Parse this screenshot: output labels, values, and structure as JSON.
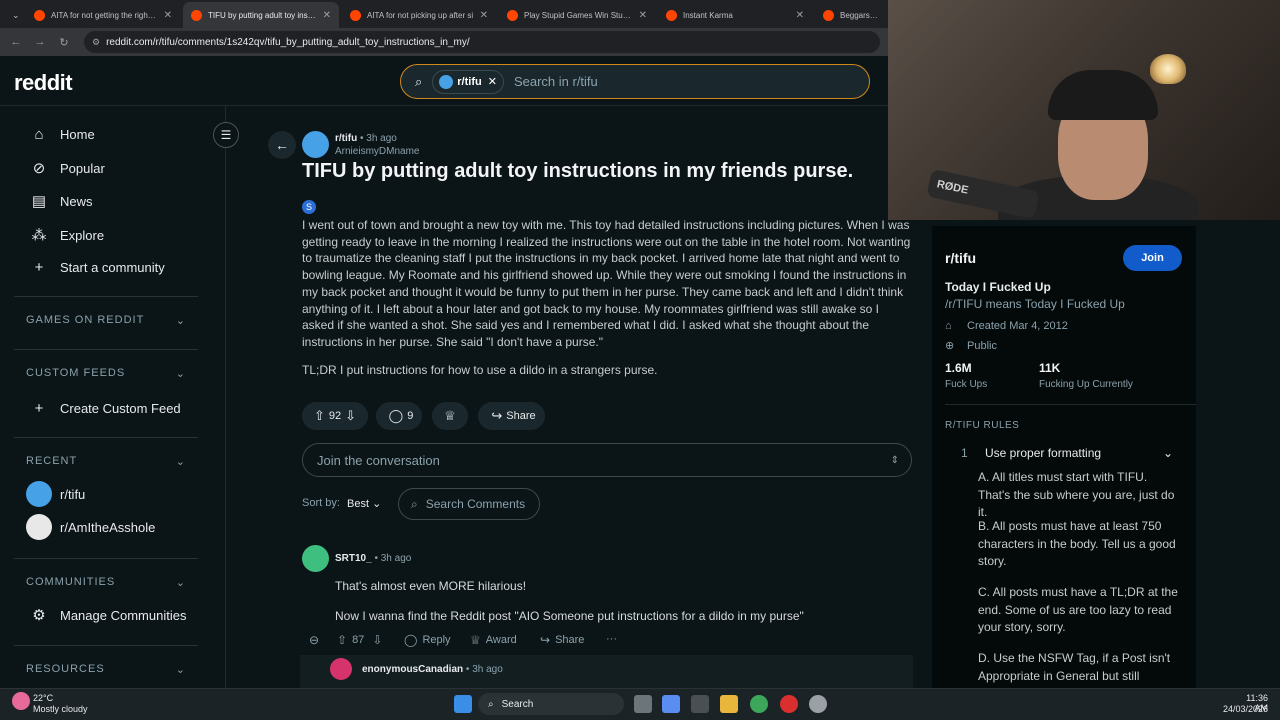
{
  "browser": {
    "tabs": [
      {
        "label": "AITA for not getting the right m",
        "active": false
      },
      {
        "label": "TIFU by putting adult toy instruc",
        "active": true
      },
      {
        "label": "AITA for not picking up after si",
        "active": false
      },
      {
        "label": "Play Stupid Games Win Stupid I",
        "active": false
      },
      {
        "label": "Instant Karma",
        "active": false
      },
      {
        "label": "Beggars can't",
        "active": false
      }
    ],
    "url": "reddit.com/r/tifu/comments/1s242qv/tifu_by_putting_adult_toy_instructions_in_my/"
  },
  "header": {
    "logo": "reddit",
    "search_chip": "r/tifu",
    "search_placeholder": "Search in r/tifu"
  },
  "sidebar": {
    "nav": [
      {
        "label": "Home",
        "icon": "home-icon"
      },
      {
        "label": "Popular",
        "icon": "popular-icon"
      },
      {
        "label": "News",
        "icon": "news-icon"
      },
      {
        "label": "Explore",
        "icon": "explore-icon"
      },
      {
        "label": "Start a community",
        "icon": "plus-icon"
      }
    ],
    "games_header": "GAMES ON REDDIT",
    "custom_feeds_header": "CUSTOM FEEDS",
    "create_custom_feed": "Create Custom Feed",
    "recent_header": "RECENT",
    "recent": [
      "r/tifu",
      "r/AmItheAsshole"
    ],
    "communities_header": "COMMUNITIES",
    "manage_communities": "Manage Communities",
    "resources_header": "RESOURCES"
  },
  "post": {
    "subreddit": "r/tifu",
    "time": "3h ago",
    "author": "ArnieismyDMname",
    "title": "TIFU by putting adult toy instructions in my friends purse.",
    "badge": "S",
    "body": "I went out of town and brought a new toy with me. This toy had detailed instructions including pictures. When I was getting ready to leave in the morning I realized the instructions were out on the table in the hotel room. Not wanting to traumatize the cleaning staff I put the instructions in my back pocket. I arrived home late that night and went to bowling league. My Roomate and his girlfriend showed up. While they were out smoking I found the instructions in my back pocket and thought it would be funny to put them in her purse. They came back and left and I didn't think anything of it. I left about a hour later and got back to my house. My roommates girlfriend was still awake so I asked if she wanted a shot. She said yes and I remembered what I did. I asked what she thought about the instructions in her purse. She said \"I don't have a purse.\"",
    "tldr": "TL;DR I put instructions for how to use a dildo in a strangers purse.",
    "votes": "92",
    "comments": "9",
    "share": "Share"
  },
  "conversation": {
    "placeholder": "Join the conversation",
    "sort_label": "Sort by:",
    "sort_value": "Best",
    "search_comments": "Search Comments"
  },
  "comments": [
    {
      "author": "SRT10_",
      "time": "3h ago",
      "lines": [
        "That's almost even MORE hilarious!",
        "Now I wanna find the Reddit post \"AIO Someone put instructions for a dildo in my purse\""
      ],
      "votes": "87",
      "reply": "Reply",
      "award": "Award",
      "share": "Share"
    },
    {
      "author": "enonymousCanadian",
      "time": "3h ago"
    }
  ],
  "community": {
    "name": "r/tifu",
    "join": "Join",
    "tagline": "Today I Fucked Up",
    "description": "/r/TIFU means Today I Fucked Up",
    "created": "Created Mar 4, 2012",
    "visibility": "Public",
    "members": "1.6M",
    "members_label": "Fuck Ups",
    "online": "11K",
    "online_label": "Fucking Up Currently",
    "rules_header": "R/TIFU RULES",
    "rule_number": "1",
    "rule_title": "Use proper formatting",
    "rules": [
      "A. All titles must start with TIFU. That's the sub where you are, just do it.",
      "B. All posts must have at least 750 characters in the body. Tell us a good story.",
      "C. All posts must have a TL;DR at the end. Some of us are too lazy to read your story, sorry.",
      "D. Use the NSFW Tag, if a Post isn't Appropriate in General but still"
    ]
  },
  "webcam": {
    "mic_label": "RØDE"
  },
  "taskbar": {
    "weather_temp": "22°C",
    "weather_desc": "Mostly cloudy",
    "search": "Search",
    "time": "11:36 AM",
    "date": "24/03/2026"
  },
  "colors": {
    "background": "#0b1416",
    "join_button": "#115bca",
    "search_border": "#d08a1a",
    "subreddit_icon": "#46a1e6"
  }
}
